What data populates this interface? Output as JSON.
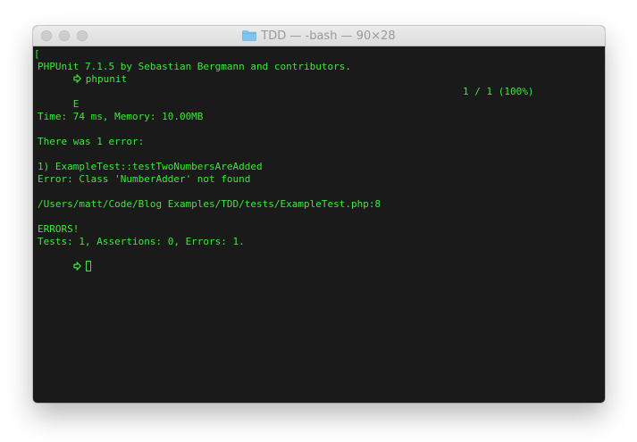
{
  "window": {
    "title": "TDD — -bash — 90×28"
  },
  "terminal": {
    "bracket_left": "[",
    "bracket_right": "]",
    "command": "phpunit",
    "lines": {
      "version": "PHPUnit 7.1.5 by Sebastian Bergmann and contributors.",
      "status_char": "E",
      "progress": "1 / 1 (100%)",
      "time": "Time: 74 ms, Memory: 10.00MB",
      "error_header": "There was 1 error:",
      "error_test": "1) ExampleTest::testTwoNumbersAreAdded",
      "error_message": "Error: Class 'NumberAdder' not found",
      "error_location": "/Users/matt/Code/Blog Examples/TDD/tests/ExampleTest.php:8",
      "errors_flag": "ERRORS!",
      "summary": "Tests: 1, Assertions: 0, Errors: 1."
    },
    "text_color": "#3ee63a",
    "background_color": "#1a1a1a"
  },
  "icons": {
    "folder": "folder-icon",
    "prompt": "arrow-right-icon"
  }
}
